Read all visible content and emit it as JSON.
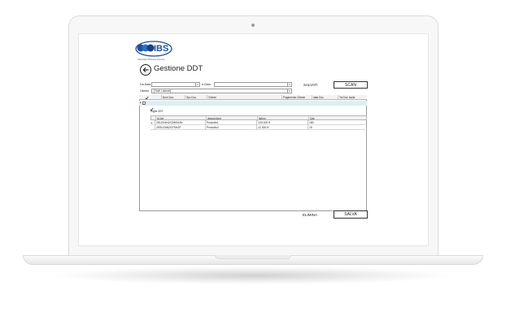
{
  "app": {
    "logo_text": "IBS",
    "logo_tagline": "Information Business Services",
    "title": "Gestione DDT"
  },
  "filters": {
    "from_date_label": "Da Data",
    "to_date_label": "a Data",
    "client_label": "Cliente",
    "client_value": "[Tutti i clienti]",
    "saved_label": "SALVATI",
    "scan_label": "SCAN"
  },
  "grid": {
    "columns": [
      "Num Doc",
      "Spc Doc",
      "Cliente",
      "Pagamento Cliente",
      "data Doc",
      "Tot Doc Iva/ia"
    ],
    "detail_caption": "Righe DDT",
    "detail_columns": [
      "Id Art",
      "descrizione",
      "listino",
      "Qta"
    ],
    "detail_rows": [
      {
        "id": "2SU224N2CD8SH4N",
        "descrizione": "Prodotto1",
        "listino": "129.000 €",
        "qta": "180"
      },
      {
        "id": "2SSU24N2CPSH2P",
        "descrizione": "Prodotto2",
        "listino": "12.300 €",
        "qta": "15"
      }
    ]
  },
  "footer": {
    "delete_label": "ELIMINA",
    "save_label": "SALVA"
  },
  "colors": {
    "accent": "#1f4fa0",
    "selected_row": "#ddeef7"
  },
  "icons": [
    "back-arrow-icon",
    "chevron-down-icon",
    "checkbox-icon",
    "expand-icon"
  ]
}
